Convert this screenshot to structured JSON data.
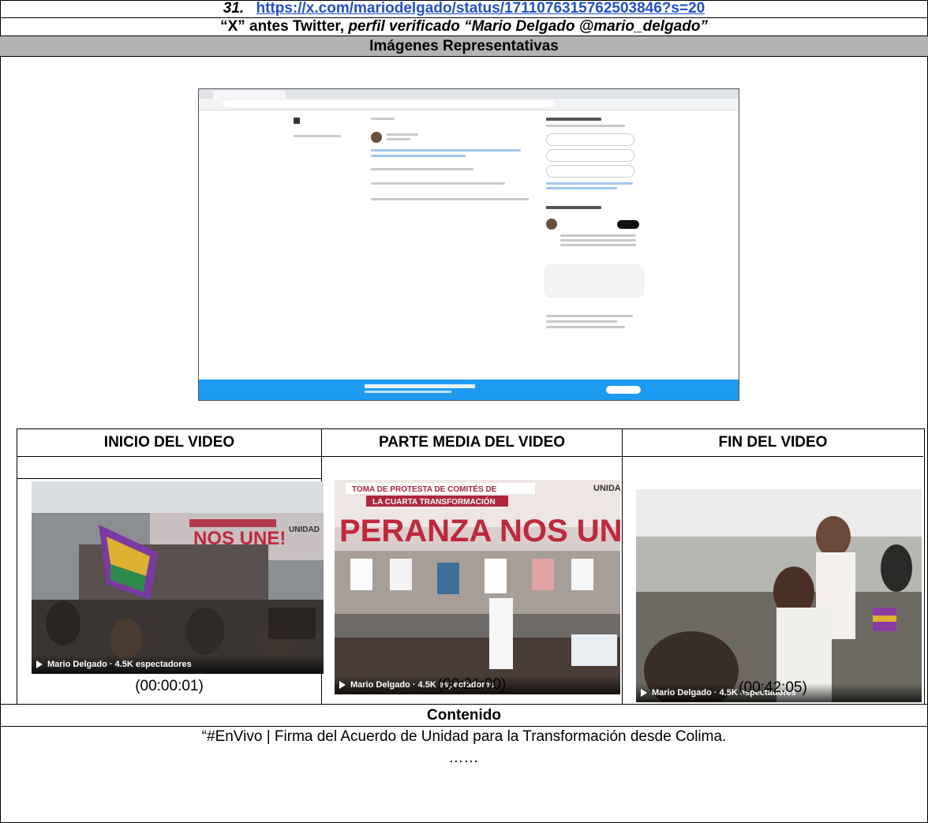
{
  "header": {
    "number": "31.",
    "url": "https://x.com/mariodelgado/status/1711076315762503846?s=20",
    "source_bold": "“X” antes Twitter, ",
    "source_italic": "perfil verificado “Mario Delgado @mario_delgado”"
  },
  "section_images": "Imágenes Representativas",
  "videos": [
    {
      "heading": "INICIO DEL VIDEO",
      "timestamp": "(00:00:01)",
      "overlay": "Mario Delgado · 4.5K espectadores"
    },
    {
      "heading": "PARTE MEDIA DEL VIDEO",
      "timestamp": "(00:21:00)",
      "overlay": "Mario Delgado · 4.5K espectadores"
    },
    {
      "heading": "FIN DEL VIDEO",
      "timestamp": "(00:42:05)",
      "overlay": "Mario Delgado · 4.5K espectadores"
    }
  ],
  "frame_banners": {
    "middle_line1": "TOMA DE PROTESTA DE COMITÉS DE",
    "middle_line2": "LA CUARTA TRANSFORMACIÓN",
    "middle_big": "PERANZA NOS UNE",
    "middle_corner": "UNIDA",
    "first_big": "NOS UNE!",
    "first_corner": "UNIDAD"
  },
  "content": {
    "heading": "Contenido",
    "text": "“#EnVivo | Firma del Acuerdo de Unidad para la Transformación desde Colima.",
    "ellipsis": "……"
  }
}
